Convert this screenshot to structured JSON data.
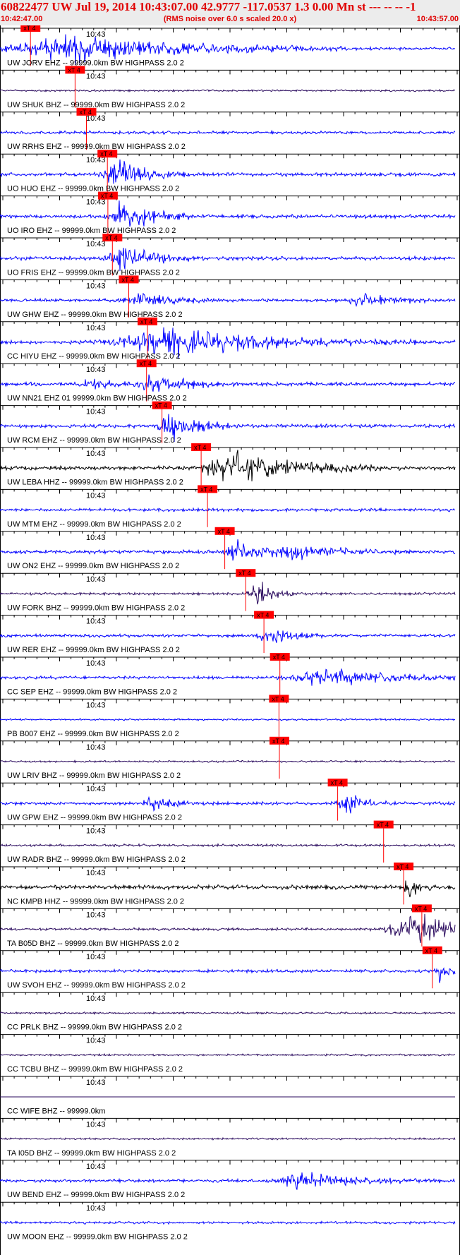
{
  "header": {
    "title": "60822477 UW Jul 19, 2014 10:43:07.00   42.9777 -117.0537  1.3 0.00 Mn st --- -- --  -1",
    "subtitle": "(RMS noise over 6.0 s scaled 20.0 x)",
    "time_start": "10:42:47.00",
    "time_end": "10:43:57.00"
  },
  "colors": {
    "header_text": "#e00000",
    "header_bg": "#ececec",
    "pick_marker": "#ff0000"
  },
  "chart_data": {
    "type": "line",
    "title": "60822477 UW Jul 19, 2014 10:43:07.00   42.9777 -117.0537  1.3 0.00 Mn st --- -- --  -1",
    "x_range": [
      "10:42:47.00",
      "10:43:57.00"
    ],
    "x_tick_label": "10:43",
    "pick_label": "xT 4",
    "grid": false,
    "legend": "none",
    "traces": [
      {
        "label": "UW JORV EHZ -- 99999.0km BW  HIGHPASS  2.0  2",
        "color": "#0000ff",
        "amp": 2.5,
        "events": [
          [
            0.16,
            0.2,
            22
          ]
        ],
        "pick": 0.067
      },
      {
        "label": "UW SHUK BHZ -- 99999.0km BW  HIGHPASS  2.0  2",
        "color": "#2a0a5e",
        "amp": 1.5,
        "events": [],
        "pick": 0.165
      },
      {
        "label": "UW RRHS EHZ -- 99999.0km BW  HIGHPASS  2.0  2",
        "color": "#0000ff",
        "amp": 2.5,
        "events": [],
        "pick": 0.19
      },
      {
        "label": "UO HUO EHZ -- 99999.0km BW  HIGHPASS  2.0  2",
        "color": "#0000ff",
        "amp": 3,
        "events": [
          [
            0.26,
            0.05,
            26
          ]
        ],
        "pick": 0.236
      },
      {
        "label": "UO IRO EHZ -- 99999.0km BW  HIGHPASS  2.0  2",
        "color": "#0000ff",
        "amp": 3,
        "events": [
          [
            0.275,
            0.05,
            26
          ]
        ],
        "pick": 0.237
      },
      {
        "label": "UO FRIS EHZ -- 99999.0km BW  HIGHPASS  2.0  2",
        "color": "#0000ff",
        "amp": 3,
        "events": [
          [
            0.27,
            0.05,
            24
          ]
        ],
        "pick": 0.247
      },
      {
        "label": "UW GHW EHZ -- 99999.0km BW  HIGHPASS  2.0  2",
        "color": "#0000ff",
        "amp": 2.5,
        "events": [
          [
            0.31,
            0.06,
            12
          ],
          [
            0.8,
            0.06,
            10
          ]
        ],
        "pick": 0.283
      },
      {
        "label": "CC HIYU EHZ -- 99999.0km BW  HIGHPASS  2.0  2",
        "color": "#0000ff",
        "amp": 3,
        "events": [
          [
            0.38,
            0.18,
            22
          ]
        ],
        "pick": 0.324
      },
      {
        "label": "UW NN21 EHZ 01 99999.0km BW  HIGHPASS  2.0  2",
        "color": "#0000ff",
        "amp": 3,
        "events": [
          [
            0.34,
            0.06,
            14
          ],
          [
            0.2,
            0.03,
            10
          ]
        ],
        "pick": 0.322
      },
      {
        "label": "UW RCM EHZ -- 99999.0km BW  HIGHPASS  2.0  2",
        "color": "#0000ff",
        "amp": 3,
        "events": [
          [
            0.38,
            0.05,
            24
          ]
        ],
        "pick": 0.356
      },
      {
        "label": "UW LEBA HHZ -- 99999.0km BW  HIGHPASS  2.0  2",
        "color": "#000000",
        "amp": 3,
        "events": [
          [
            0.52,
            0.12,
            24
          ]
        ],
        "pick": 0.442
      },
      {
        "label": "UW MTM EHZ -- 99999.0km BW  HIGHPASS  2.0  2",
        "color": "#0000ff",
        "amp": 2.5,
        "events": [],
        "pick": 0.456
      },
      {
        "label": "UW ON2 EHZ -- 99999.0km BW  HIGHPASS  2.0  2",
        "color": "#0000ff",
        "amp": 3,
        "events": [
          [
            0.52,
            0.05,
            16
          ],
          [
            0.66,
            0.08,
            10
          ]
        ],
        "pick": 0.494
      },
      {
        "label": "UW FORK BHZ -- 99999.0km BW  HIGHPASS  2.0  2",
        "color": "#2a0a5e",
        "amp": 2,
        "events": [
          [
            0.565,
            0.03,
            24
          ]
        ],
        "pick": 0.54
      },
      {
        "label": "UW RER EHZ -- 99999.0km BW  HIGHPASS  2.0  2",
        "color": "#0000ff",
        "amp": 2.5,
        "events": [
          [
            0.595,
            0.04,
            16
          ]
        ],
        "pick": 0.58
      },
      {
        "label": "CC SEP EHZ -- 99999.0km BW  HIGHPASS  2.0  2",
        "color": "#0000ff",
        "amp": 2.5,
        "events": [
          [
            0.72,
            0.12,
            14
          ]
        ],
        "pick": 0.615
      },
      {
        "label": "PB B007 EHZ -- 99999.0km BW  HIGHPASS  2.0  2",
        "color": "#0000ff",
        "amp": 1.5,
        "events": [],
        "pick": 0.613
      },
      {
        "label": "UW LRIV BHZ -- 99999.0km BW  HIGHPASS  2.0  2",
        "color": "#2a0a5e",
        "amp": 1.5,
        "events": [],
        "pick": 0.614
      },
      {
        "label": "UW GPW EHZ -- 99999.0km BW  HIGHPASS  2.0  2",
        "color": "#0000ff",
        "amp": 2.5,
        "events": [
          [
            0.76,
            0.03,
            18
          ],
          [
            0.34,
            0.04,
            10
          ]
        ],
        "pick": 0.742
      },
      {
        "label": "UW RADR BHZ -- 99999.0km BW  HIGHPASS  2.0  2",
        "color": "#2a0a5e",
        "amp": 2,
        "events": [],
        "pick": 0.843
      },
      {
        "label": "NC KMPB HHZ -- 99999.0km BW  HIGHPASS  2.0  2",
        "color": "#000000",
        "amp": 3.5,
        "events": [
          [
            0.9,
            0.02,
            16
          ]
        ],
        "pick": 0.887
      },
      {
        "label": "TA B05D BHZ -- 99999.0km BW  HIGHPASS  2.0  2",
        "color": "#2a0a5e",
        "amp": 2,
        "events": [
          [
            0.91,
            0.09,
            26
          ]
        ],
        "pick": 0.927
      },
      {
        "label": "UW SVOH EHZ -- 99999.0km BW  HIGHPASS  2.0  2",
        "color": "#0000ff",
        "amp": 2.5,
        "events": [
          [
            0.965,
            0.02,
            16
          ]
        ],
        "pick": 0.95
      },
      {
        "label": "CC PRLK BHZ -- 99999.0km BW  HIGHPASS  2.0  2",
        "color": "#2a0a5e",
        "amp": 1.5,
        "events": [],
        "pick": null
      },
      {
        "label": "CC TCBU BHZ -- 99999.0km BW  HIGHPASS  2.0  2",
        "color": "#2a0a5e",
        "amp": 1.5,
        "events": [],
        "pick": null
      },
      {
        "label": "CC WIFE BHZ -- 99999.0km",
        "color": "#2a0a5e",
        "amp": 0,
        "events": [],
        "pick": null
      },
      {
        "label": "TA I05D BHZ -- 99999.0km BW  HIGHPASS  2.0  2",
        "color": "#2a0a5e",
        "amp": 1.5,
        "events": [],
        "pick": null
      },
      {
        "label": "UW BEND EHZ -- 99999.0km BW  HIGHPASS  2.0  2",
        "color": "#0000ff",
        "amp": 2.5,
        "events": [
          [
            0.67,
            0.1,
            12
          ]
        ],
        "pick": null
      },
      {
        "label": "UW MOON EHZ -- 99999.0km BW  HIGHPASS  2.0  2",
        "color": "#0000ff",
        "amp": 2,
        "events": [],
        "pick": null
      }
    ]
  }
}
